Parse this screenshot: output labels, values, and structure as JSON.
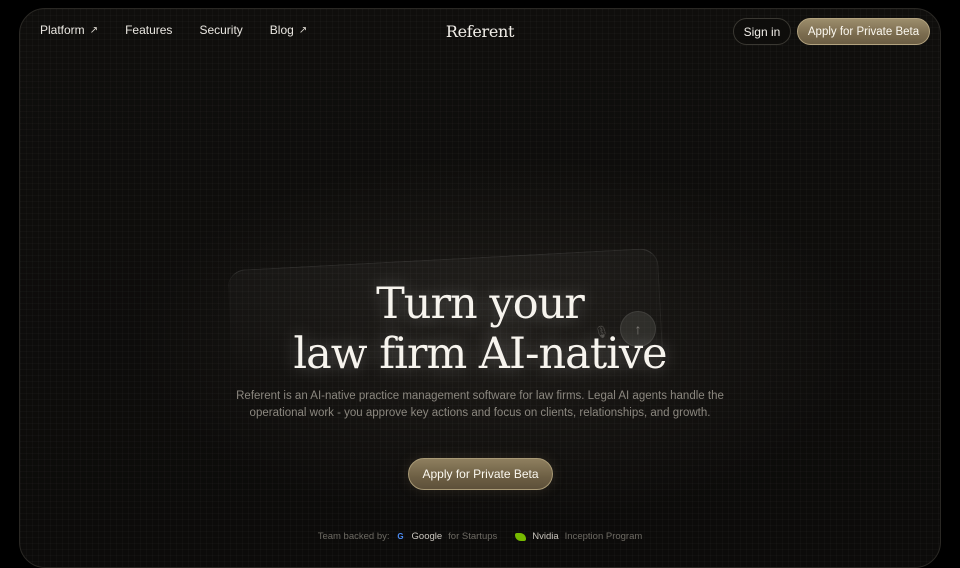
{
  "nav": {
    "links": [
      {
        "label": "Platform",
        "external": true
      },
      {
        "label": "Features",
        "external": false
      },
      {
        "label": "Security",
        "external": false
      },
      {
        "label": "Blog",
        "external": true
      }
    ],
    "external_icon": "arrow-up-right-icon",
    "brand": "Referent",
    "sign_in": "Sign in",
    "cta": "Apply for Private Beta"
  },
  "hero": {
    "title_line1": "Turn your",
    "title_line2": "law firm AI-native",
    "subtitle_line1": "Referent is an AI-native practice management software for law firms. Legal AI agents handle the",
    "subtitle_line2": "operational work - you approve key actions and focus on clients, relationships, and growth.",
    "cta": "Apply for Private Beta"
  },
  "backers": {
    "label": "Team backed by:",
    "google_name": "Google",
    "google_program": "for Startups",
    "nvidia_name": "Nvidia",
    "nvidia_program": "Inception Program"
  },
  "colors": {
    "background": "#0e0d0b",
    "accent_gold": "#8e7f5f",
    "text_light": "#f1eee8",
    "text_muted": "#8b877f"
  }
}
